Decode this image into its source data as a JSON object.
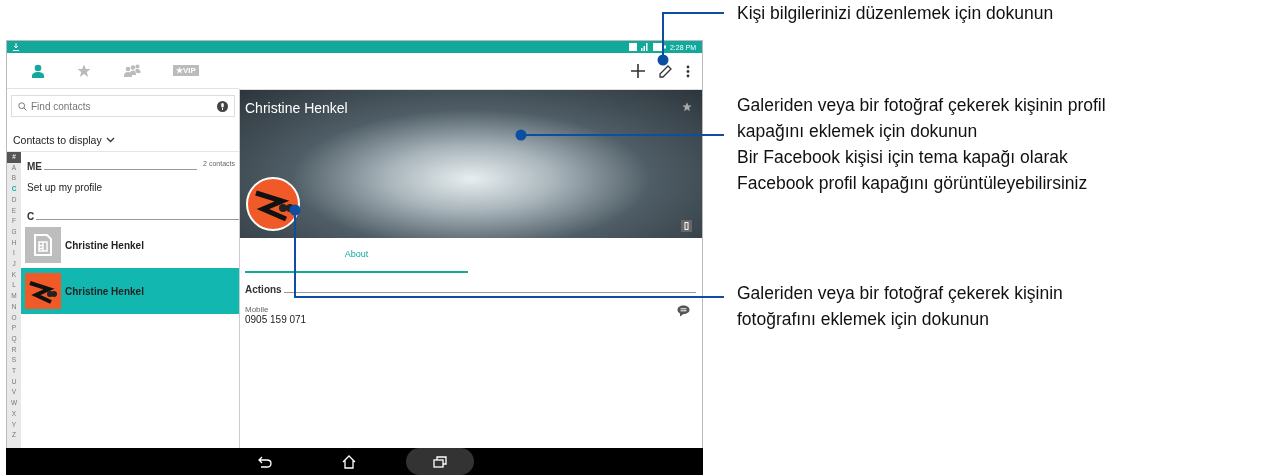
{
  "status_bar": {
    "time": "2:28 PM"
  },
  "tabs": [
    {
      "kind": "person",
      "selected": true
    },
    {
      "kind": "star",
      "selected": false
    },
    {
      "kind": "group",
      "selected": false
    },
    {
      "kind": "vip",
      "label": "★VIP",
      "selected": false
    }
  ],
  "search": {
    "placeholder": "Find contacts"
  },
  "filter": {
    "label": "Contacts to display"
  },
  "index": [
    {
      "letter": "#",
      "selected": false
    },
    {
      "letter": "A",
      "selected": false
    },
    {
      "letter": "B",
      "selected": false
    },
    {
      "letter": "C",
      "selected": true
    },
    {
      "letter": "D",
      "selected": false
    },
    {
      "letter": "E",
      "selected": false
    },
    {
      "letter": "F",
      "selected": false
    },
    {
      "letter": "G",
      "selected": false
    },
    {
      "letter": "H",
      "selected": false
    },
    {
      "letter": "I",
      "selected": false
    },
    {
      "letter": "J",
      "selected": false
    },
    {
      "letter": "K",
      "selected": false
    },
    {
      "letter": "L",
      "selected": false
    },
    {
      "letter": "M",
      "selected": false
    },
    {
      "letter": "N",
      "selected": false
    },
    {
      "letter": "O",
      "selected": false
    },
    {
      "letter": "P",
      "selected": false
    },
    {
      "letter": "Q",
      "selected": false
    },
    {
      "letter": "R",
      "selected": false
    },
    {
      "letter": "S",
      "selected": false
    },
    {
      "letter": "T",
      "selected": false
    },
    {
      "letter": "U",
      "selected": false
    },
    {
      "letter": "V",
      "selected": false
    },
    {
      "letter": "W",
      "selected": false
    },
    {
      "letter": "X",
      "selected": false
    },
    {
      "letter": "Y",
      "selected": false
    },
    {
      "letter": "Z",
      "selected": false
    }
  ],
  "sections": [
    {
      "header": "ME",
      "count": "2 contacts",
      "items": [
        {
          "kind": "setup",
          "name": "Set up my profile",
          "selected": false
        }
      ]
    },
    {
      "header": "C",
      "items": [
        {
          "kind": "sim",
          "name": "Christine Henkel",
          "selected": false
        },
        {
          "kind": "photo",
          "name": "Christine Henkel",
          "selected": true
        }
      ]
    }
  ],
  "detail": {
    "name": "Christine Henkel",
    "tabs": [
      {
        "label": "About",
        "selected": true
      }
    ],
    "section": "Actions",
    "fields": [
      {
        "label": "Mobile",
        "value": "0905 159 071"
      }
    ]
  },
  "callouts": [
    {
      "kind": "edit",
      "paragraphs": [
        "Kişi bilgilerinizi düzenlemek için dokunun"
      ]
    },
    {
      "kind": "cover",
      "paragraphs": [
        "Galeriden veya bir fotoğraf çekerek kişinin profil kapağını eklemek için dokunun",
        "Bir Facebook kişisi için tema kapağı olarak Facebook profil kapağını görüntüleyebilirsiniz"
      ]
    },
    {
      "kind": "photo",
      "paragraphs": [
        "Galeriden veya bir fotoğraf çekerek kişinin fotoğrafını eklemek için dokunun"
      ]
    }
  ]
}
